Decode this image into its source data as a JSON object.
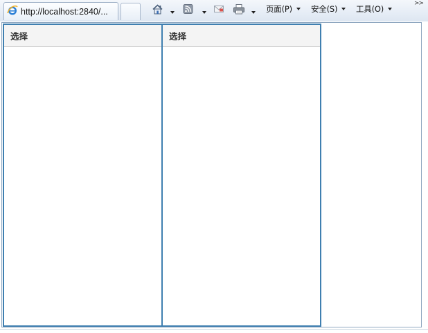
{
  "browser": {
    "tab_title": "http://localhost:2840/...",
    "toolbar": {
      "page_menu": "页面(P)",
      "safety_menu": "安全(S)",
      "tools_menu": "工具(O)",
      "overflow": ">>"
    },
    "icons": [
      "ie-page-icon",
      "home-icon",
      "feeds-icon",
      "mail-icon",
      "print-icon"
    ]
  },
  "content": {
    "grids": [
      {
        "header": "选择"
      },
      {
        "header": "选择"
      }
    ]
  },
  "colors": {
    "grid_border": "#3f7fb0",
    "header_background": "#f4f4f4",
    "toolbar_background": "#e6edf6"
  }
}
